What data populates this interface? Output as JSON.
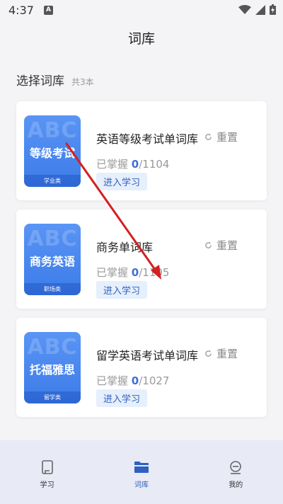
{
  "status_bar": {
    "time": "4:37",
    "a_badge": "A"
  },
  "header": {
    "title": "词库"
  },
  "section": {
    "title": "选择词库",
    "count": "共3本"
  },
  "books": [
    {
      "cover_bg": "ABC",
      "cover_name": "等级考试",
      "cover_category": "学业类",
      "title": "英语等级考试单词库",
      "reset_label": "重置",
      "mastered_label": "已掌握 ",
      "mastered_count": "0",
      "total": "/1104",
      "learn_label": "进入学习"
    },
    {
      "cover_bg": "ABC",
      "cover_name": "商务英语",
      "cover_category": "职场类",
      "title": "商务单词库",
      "reset_label": "重置",
      "mastered_label": "已掌握 ",
      "mastered_count": "0",
      "total": "/1105",
      "learn_label": "进入学习"
    },
    {
      "cover_bg": "ABC",
      "cover_name": "托福雅思",
      "cover_category": "留学类",
      "title": "留学英语考试单词库",
      "reset_label": "重置",
      "mastered_label": "已掌握 ",
      "mastered_count": "0",
      "total": "/1027",
      "learn_label": "进入学习"
    }
  ],
  "nav": {
    "items": [
      {
        "label": "学习",
        "icon": "study-icon"
      },
      {
        "label": "词库",
        "icon": "folder-icon"
      },
      {
        "label": "我的",
        "icon": "profile-icon"
      }
    ]
  },
  "colors": {
    "accent": "#2f5fc0",
    "cover_blue": "#4a88f0",
    "annotation_arrow": "#d42020"
  }
}
